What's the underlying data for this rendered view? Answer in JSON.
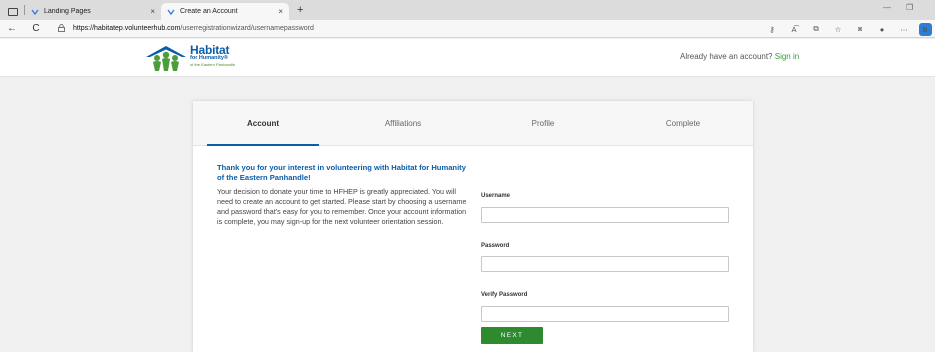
{
  "browser": {
    "tabs": [
      {
        "title": "Landing Pages",
        "close": "×"
      },
      {
        "title": "Create an Account",
        "close": "×"
      }
    ],
    "new_tab": "+",
    "back": "←",
    "reload": "C",
    "url_domain": "https://habitatep.volunteerhub.com",
    "url_path": "/userregistrationwizard/usernamepassword",
    "minimize": "—",
    "restore": "❐",
    "bing": "b"
  },
  "site": {
    "logo_line1": "Habitat",
    "logo_line2": "for Humanity®",
    "logo_line3": "of the Eastern Panhandle",
    "signin_prompt": "Already have an account? ",
    "signin_link": "Sign in"
  },
  "wizard": {
    "steps": [
      "Account",
      "Affiliations",
      "Profile",
      "Complete"
    ],
    "heading": "Thank you for your interest in volunteering with Habitat for Humanity of the Eastern Panhandle!",
    "body": "Your decision to donate your time to HFHEP is greatly appreciated. You will need to create an account to get started. Please start by choosing a username and password that's easy for you to remember. Once your account information is complete, you may sign-up for the next volunteer orientation session.",
    "fields": {
      "username_label": "Username",
      "username_value": "",
      "password_label": "Password",
      "password_value": "",
      "verify_label": "Verify Password",
      "verify_value": ""
    },
    "next_label": "NEXT"
  },
  "colors": {
    "brand_blue": "#0a5da8",
    "brand_green": "#2e8a2e"
  }
}
